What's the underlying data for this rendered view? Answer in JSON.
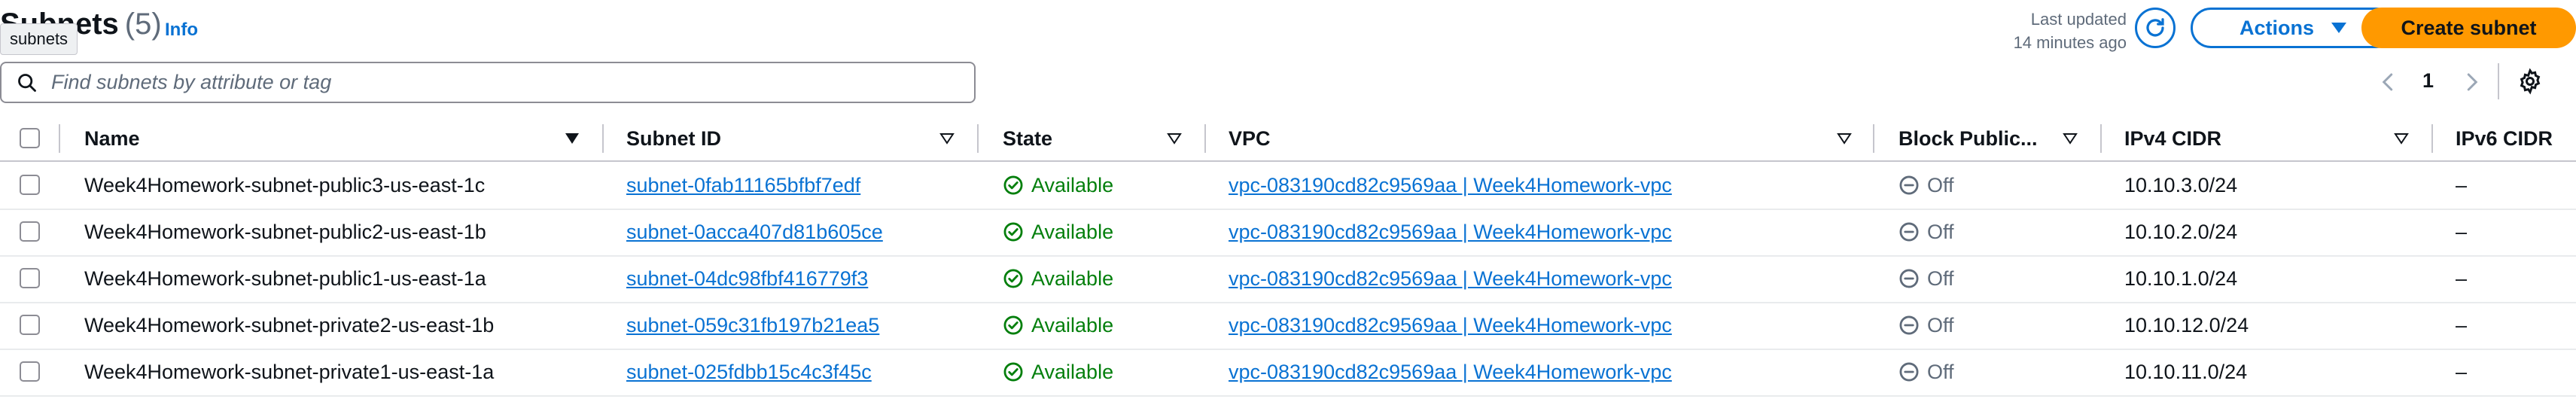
{
  "header": {
    "title": "Subnets",
    "count": "(5)",
    "info": "Info",
    "tooltip": "subnets",
    "last_updated_line1": "Last updated",
    "last_updated_line2": "14 minutes ago",
    "actions_label": "Actions",
    "create_label": "Create subnet"
  },
  "search": {
    "placeholder": "Find subnets by attribute or tag"
  },
  "pagination": {
    "current_page": "1"
  },
  "columns": [
    "Name",
    "Subnet ID",
    "State",
    "VPC",
    "Block Public...",
    "IPv4 CIDR",
    "IPv6 CIDR"
  ],
  "rows": [
    {
      "name": "Week4Homework-subnet-public3-us-east-1c",
      "subnet_id": "subnet-0fab11165bfbf7edf",
      "state": "Available",
      "vpc": "vpc-083190cd82c9569aa | Week4Homework-vpc",
      "block": "Off",
      "ipv4": "10.10.3.0/24",
      "ipv6": "–"
    },
    {
      "name": "Week4Homework-subnet-public2-us-east-1b",
      "subnet_id": "subnet-0acca407d81b605ce",
      "state": "Available",
      "vpc": "vpc-083190cd82c9569aa | Week4Homework-vpc",
      "block": "Off",
      "ipv4": "10.10.2.0/24",
      "ipv6": "–"
    },
    {
      "name": "Week4Homework-subnet-public1-us-east-1a",
      "subnet_id": "subnet-04dc98fbf416779f3",
      "state": "Available",
      "vpc": "vpc-083190cd82c9569aa | Week4Homework-vpc",
      "block": "Off",
      "ipv4": "10.10.1.0/24",
      "ipv6": "–"
    },
    {
      "name": "Week4Homework-subnet-private2-us-east-1b",
      "subnet_id": "subnet-059c31fb197b21ea5",
      "state": "Available",
      "vpc": "vpc-083190cd82c9569aa | Week4Homework-vpc",
      "block": "Off",
      "ipv4": "10.10.12.0/24",
      "ipv6": "–"
    },
    {
      "name": "Week4Homework-subnet-private1-us-east-1a",
      "subnet_id": "subnet-025fdbb15c4c3f45c",
      "state": "Available",
      "vpc": "vpc-083190cd82c9569aa | Week4Homework-vpc",
      "block": "Off",
      "ipv4": "10.10.11.0/24",
      "ipv6": "–"
    }
  ],
  "colors": {
    "link": "#0972d3",
    "available": "#037f0c",
    "primary_button": "#ff9900",
    "muted": "#5f6b7a"
  }
}
